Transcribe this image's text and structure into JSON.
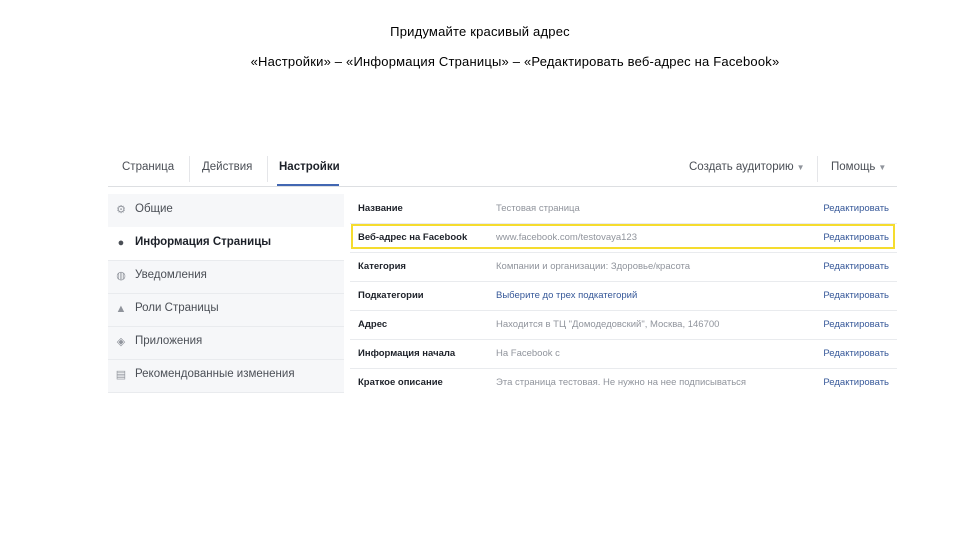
{
  "slide": {
    "title": "Придумайте красивый адрес",
    "subtitle": "«Настройки» – «Информация Страницы» – «Редактировать веб-адрес на Facebook»"
  },
  "topnav": {
    "tabs": [
      "Страница",
      "Действия",
      "Настройки"
    ],
    "active_tab": "Настройки",
    "create_audience": "Создать аудиторию",
    "help": "Помощь"
  },
  "sidebar": {
    "items": [
      {
        "label": "Общие",
        "icon": "gear-icon"
      },
      {
        "label": "Информация Страницы",
        "icon": "info-icon",
        "active": true
      },
      {
        "label": "Уведомления",
        "icon": "globe-icon"
      },
      {
        "label": "Роли Страницы",
        "icon": "person-icon"
      },
      {
        "label": "Приложения",
        "icon": "apps-icon"
      },
      {
        "label": "Рекомендованные изменения",
        "icon": "suggest-icon"
      }
    ]
  },
  "info_rows": [
    {
      "key": "Название",
      "value": "Тестовая страница",
      "edit": "Редактировать"
    },
    {
      "key": "Веб-адрес на Facebook",
      "value": "www.facebook.com/testovaya123",
      "edit": "Редактировать",
      "highlighted": true
    },
    {
      "key": "Категория",
      "value": "Компании и организации: Здоровье/красота",
      "edit": "Редактировать"
    },
    {
      "key": "Подкатегории",
      "value": "Выберите до трех подкатегорий",
      "edit": "Редактировать",
      "value_is_link": true
    },
    {
      "key": "Адрес",
      "value": "Находится в ТЦ \"Домодедовский\", Москва, 146700",
      "edit": "Редактировать"
    },
    {
      "key": "Информация начала",
      "value": "На Facebook с",
      "edit": "Редактировать"
    },
    {
      "key": "Краткое описание",
      "value": "Эта страница тестовая. Не нужно на нее подписываться",
      "edit": "Редактировать"
    }
  ],
  "colors": {
    "link": "#365899",
    "highlight": "#f5dc2e",
    "sidebar_bg": "#f6f7f9",
    "accent": "#4267b2"
  }
}
